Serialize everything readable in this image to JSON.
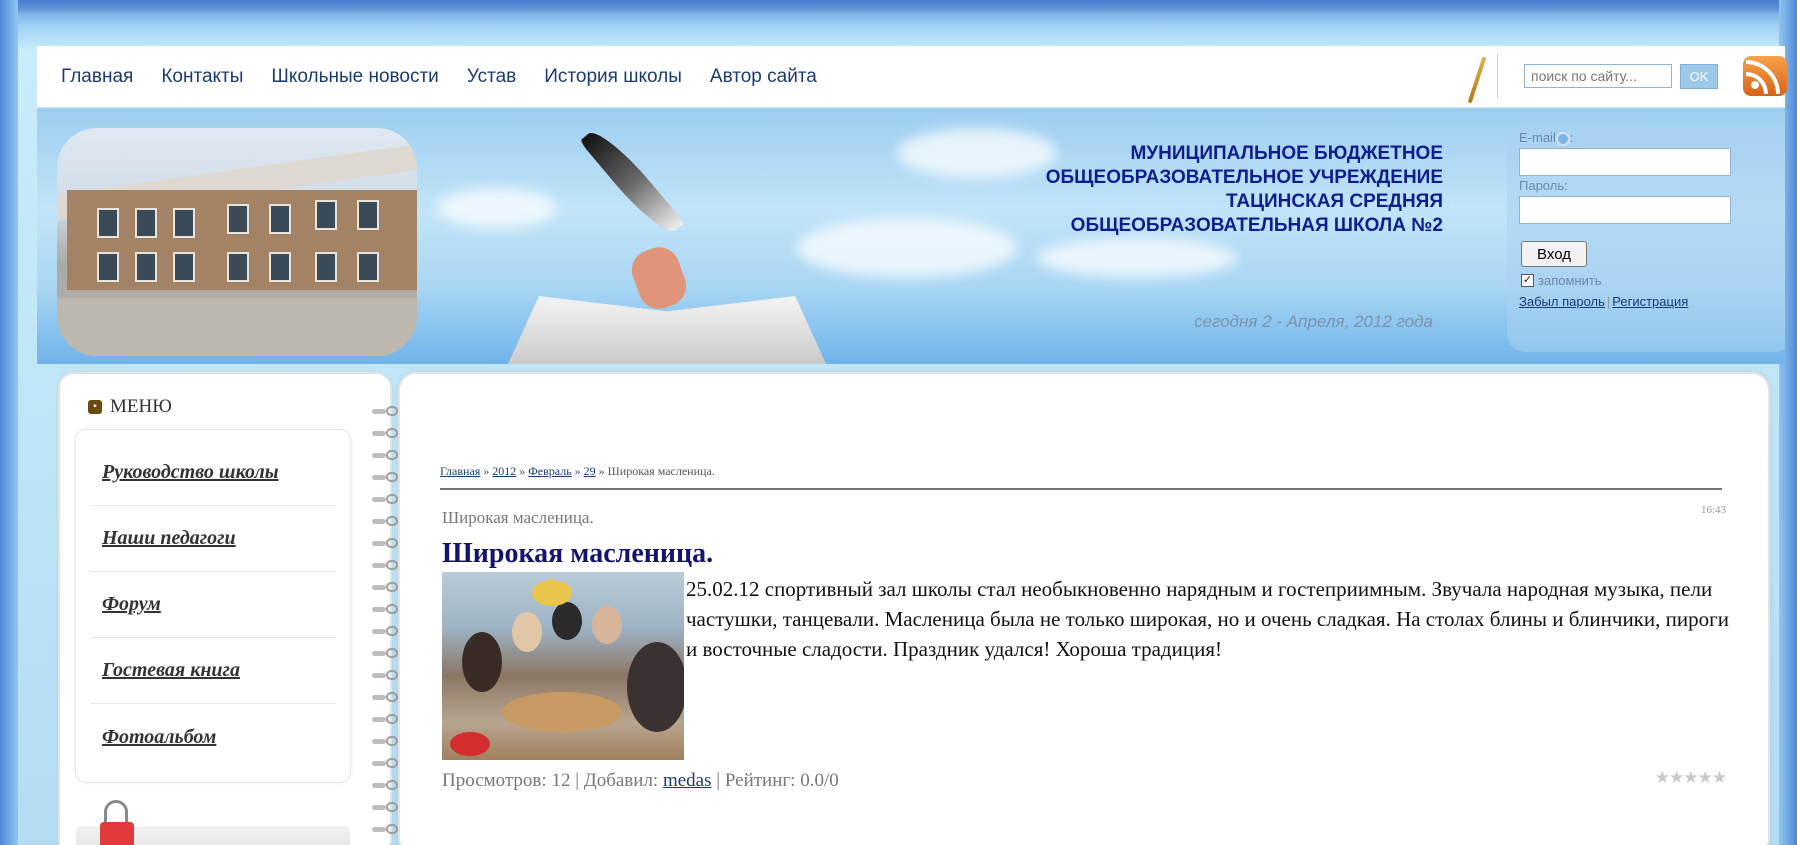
{
  "nav": {
    "items": [
      "Главная",
      "Контакты",
      "Школьные новости",
      "Устав",
      "История школы",
      "Автор сайта"
    ]
  },
  "search": {
    "placeholder": "поиск по сайту...",
    "button": "OK"
  },
  "header": {
    "school_title_lines": [
      "МУНИЦИПАЛЬНОЕ БЮДЖЕТНОЕ",
      "ОБЩЕОБРАЗОВАТЕЛЬНОЕ УЧРЕЖДЕНИЕ",
      "ТАЦИНСКАЯ СРЕДНЯЯ",
      "ОБЩЕОБРАЗОВАТЕЛЬНАЯ ШКОЛА №2"
    ],
    "today": "сегодня 2 - Апреля, 2012 года"
  },
  "login": {
    "email_label": "E-mail",
    "email_suffix": ":",
    "password_label": "Пароль:",
    "submit": "Вход",
    "remember_label": "запомнить",
    "remember_checked": true,
    "forgot_link": "Забыл пароль",
    "register_link": "Регистрация"
  },
  "menu": {
    "title": "МЕНЮ",
    "items": [
      "Руководство школы",
      "Наши педагоги",
      "Форум",
      "Гостевая книга",
      "Фотоальбом"
    ]
  },
  "breadcrumb": {
    "home": "Главная",
    "year": "2012",
    "month": "Февраль",
    "day": "29",
    "current": "Широкая масленица.",
    "sep": " » "
  },
  "post": {
    "subtitle": "Широкая масленица.",
    "time": "16:43",
    "title": "Широкая масленица.",
    "text": "25.02.12 спортивный зал школы стал необыкновенно нарядным и гостеприимным. Звучала народная музыка, пели частушки, танцевали. Масленица была не только широкая, но и очень сладкая. На столах блины и блинчики, пироги и восточные сладости. Праздник удался! Хороша традиция!",
    "views_label": "Просмотров:",
    "views": "12",
    "added_label": "Добавил:",
    "author": "medas",
    "rating_label": "Рейтинг:",
    "rating": "0.0/0",
    "stars": "★★★★★"
  },
  "colors": {
    "nav_text": "#1b3b6f",
    "title_blue": "#0f1e8c",
    "post_title": "#14146e",
    "rss_orange": "#e07526"
  },
  "icons": [
    "rss-icon",
    "at-icon",
    "menu-badge-icon",
    "paperclip-icon",
    "star-rating-icon"
  ]
}
